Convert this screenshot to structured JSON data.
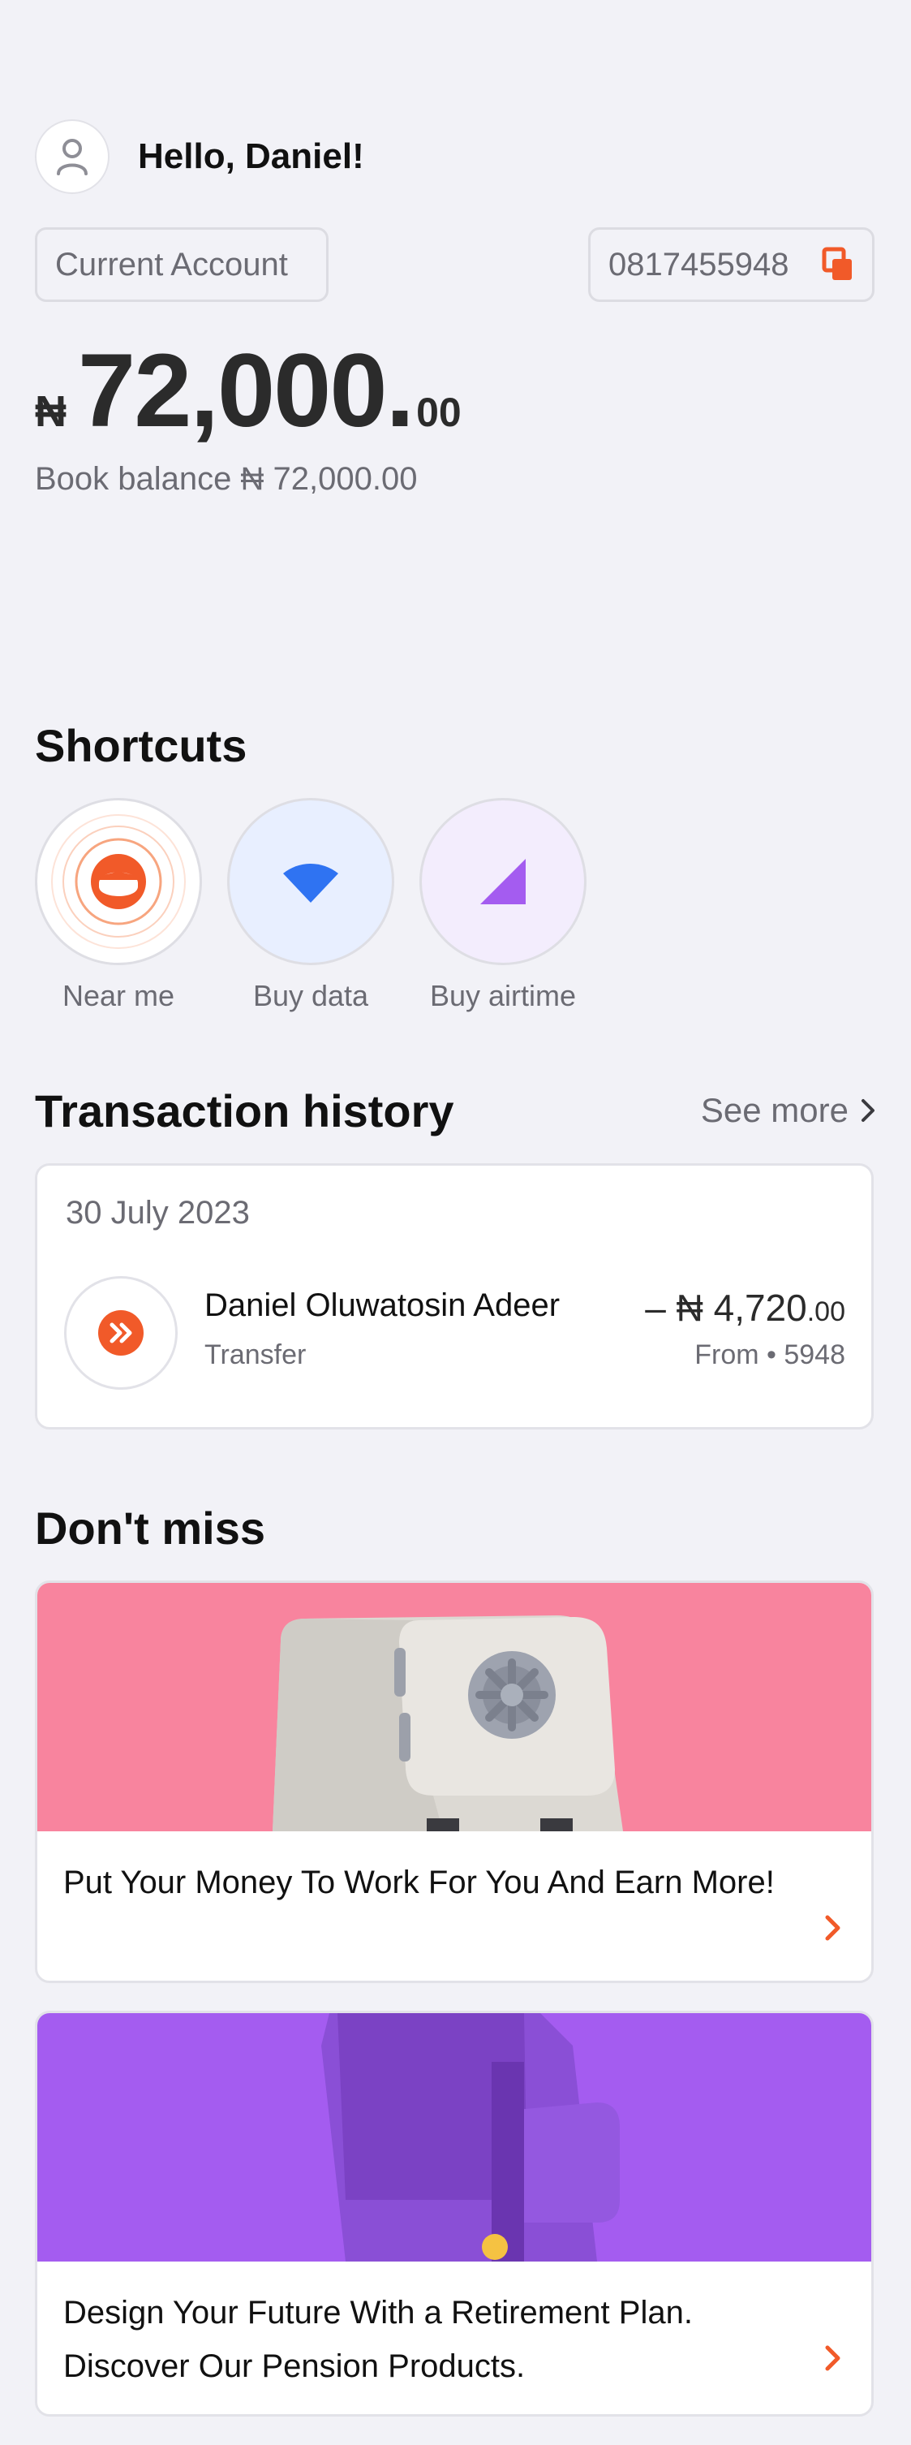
{
  "header": {
    "greeting": "Hello, Daniel!"
  },
  "account": {
    "type_label": "Current Account",
    "number": "0817455948",
    "currency_symbol": "₦",
    "balance_main": "72,000.",
    "balance_fraction": "00",
    "book_balance_label": "Book balance",
    "book_balance_value": "₦ 72,000.00"
  },
  "shortcuts": {
    "title": "Shortcuts",
    "items": [
      {
        "label": "Near me",
        "icon": "location-face-icon"
      },
      {
        "label": "Buy data",
        "icon": "wifi-icon"
      },
      {
        "label": "Buy airtime",
        "icon": "signal-icon"
      }
    ]
  },
  "transactions": {
    "title": "Transaction history",
    "see_more": "See more",
    "date": "30 July 2023",
    "items": [
      {
        "name": "Daniel Oluwatosin Adeer",
        "type": "Transfer",
        "amount_main": "– ₦ 4,720",
        "amount_fraction": ".00",
        "from": "From • 5948"
      }
    ]
  },
  "dont_miss": {
    "title": "Don't miss",
    "items": [
      {
        "text": "Put Your Money To Work For You And Earn More!",
        "image": "safe-illustration"
      },
      {
        "text": "Design Your Future With a Retirement Plan. Discover Our Pension Products.",
        "image": "wallet-illustration"
      }
    ]
  },
  "colors": {
    "accent": "#f15a29",
    "background": "#f2f2f7",
    "promo_pink": "#f8849e",
    "promo_purple": "#a45cf0"
  }
}
